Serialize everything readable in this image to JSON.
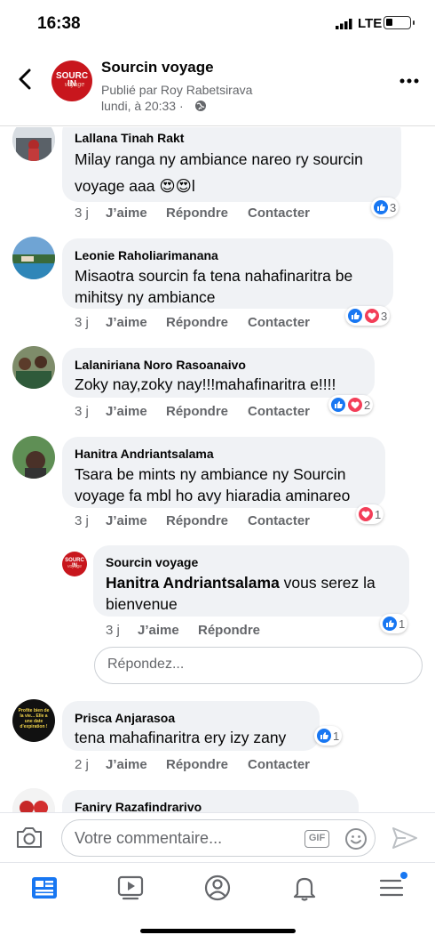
{
  "status_bar": {
    "time": "16:38",
    "network": "LTE"
  },
  "header": {
    "title": "Sourcin voyage",
    "subtitle": "Publié par Roy Rabetsirava",
    "timestamp": "lundi, à 20:33 ·",
    "logo_text": "SOURC IN",
    "logo_sub": "voyage"
  },
  "actions": {
    "like": "J’aime",
    "reply": "Répondre",
    "contact": "Contacter"
  },
  "comments": [
    {
      "author": "Lallana Tinah Rakt",
      "text_line1": "Milay ranga ny ambiance nareo ry sourcin",
      "text_line2": "voyage aaa 😍😍l",
      "age": "3 j",
      "reactions": [
        "like"
      ],
      "count": "3"
    },
    {
      "author": "Leonie Raholiarimanana",
      "text_line1": "Misaotra sourcin fa tena nahafinaritra be",
      "text_line2": "mihitsy ny ambiance",
      "age": "3 j",
      "reactions": [
        "like",
        "love"
      ],
      "count": "3"
    },
    {
      "author": "Lalaniriana Noro Rasoanaivo",
      "text_line1": "Zoky nay,zoky nay!!!mahafinaritra e!!!!",
      "age": "3 j",
      "reactions": [
        "like",
        "love"
      ],
      "count": "2"
    },
    {
      "author": "Hanitra Andriantsalama",
      "text_line1": "Tsara be mints ny ambiance ny Sourcin",
      "text_line2": "voyage fa mbl ho avy hiaradia aminareo",
      "age": "3 j",
      "reactions": [
        "love"
      ],
      "count": "1"
    },
    {
      "author": "Prisca Anjarasoa",
      "text_line1": "tena mahafinaritra ery izy zany",
      "age": "2 j",
      "reactions": [
        "like"
      ],
      "count": "1"
    },
    {
      "author": "Faniry Razafindrarivo"
    }
  ],
  "reply": {
    "author": "Sourcin voyage",
    "mention": "Hanitra Andriantsalama",
    "text_rest": " vous serez la",
    "text_line2": "bienvenue",
    "age": "3 j",
    "count": "1"
  },
  "reply_input_placeholder": "Répondez...",
  "prisca_avatar_text": "Profite bien de la vie... Elle a une date d'expiration !",
  "composer": {
    "placeholder": "Votre commentaire...",
    "gif_label": "GIF"
  },
  "tabs": [
    "news-feed",
    "watch",
    "profile",
    "notifications",
    "menu"
  ],
  "colors": {
    "like_blue": "#1877f2",
    "love_red": "#f33e58",
    "brand_red": "#c8161d",
    "active_tab": "#1877f2"
  }
}
